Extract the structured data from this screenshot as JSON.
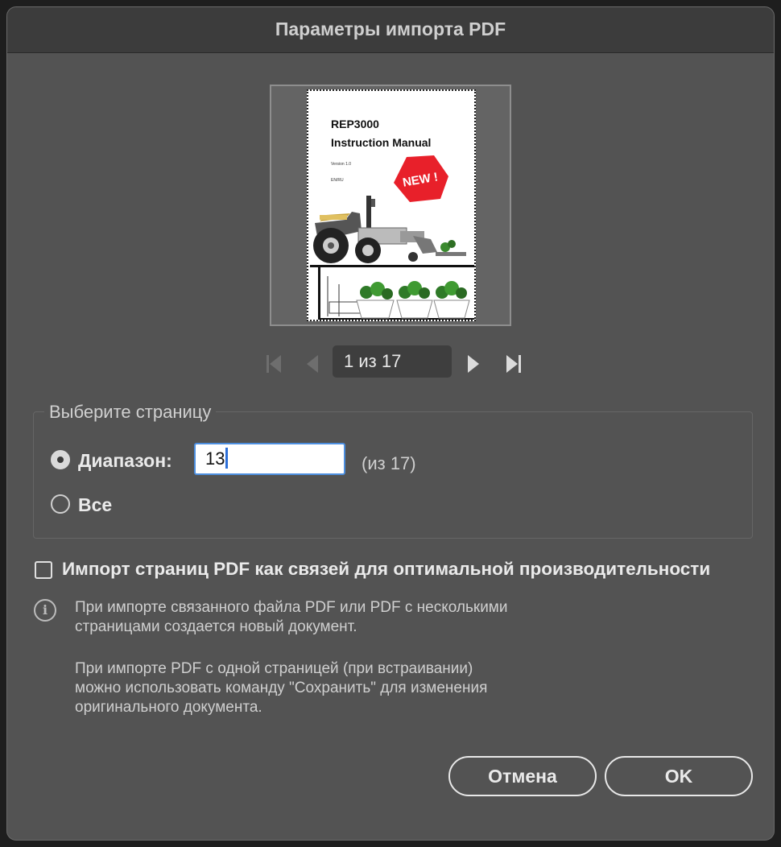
{
  "dialog": {
    "title": "Параметры импорта PDF"
  },
  "preview": {
    "doc_title_line1": "REP3000",
    "doc_title_line2": "Instruction Manual",
    "doc_version": "Version 1.0",
    "doc_small": "EN/RU",
    "badge_text": "NEW !"
  },
  "navigation": {
    "page_indicator": "1 из 17",
    "icons": [
      "first-page-icon",
      "previous-page-icon",
      "next-page-icon",
      "last-page-icon"
    ]
  },
  "page_select": {
    "legend": "Выберите страницу",
    "range_label": "Диапазон:",
    "range_value": "13",
    "range_of": "(из 17)",
    "all_label": "Все",
    "selected": "range"
  },
  "options": {
    "import_links_label": "Импорт страниц PDF как связей для оптимальной производительности",
    "import_links_checked": false
  },
  "info": {
    "paragraph1_line1": "При импорте связанного файла PDF или PDF с несколькими",
    "paragraph1_line2": "страницами создается новый документ.",
    "paragraph2_line1": "При импорте PDF с одной страницей (при встраивании)",
    "paragraph2_line2": "можно использовать команду \"Сохранить\" для изменения",
    "paragraph2_line3": "оригинального документа."
  },
  "buttons": {
    "cancel": "Отмена",
    "ok": "OK"
  },
  "colors": {
    "dialog_bg": "#535353",
    "titlebar_bg": "#3c3c3c",
    "input_focus": "#4d8fe0",
    "badge_red": "#e8202a"
  }
}
